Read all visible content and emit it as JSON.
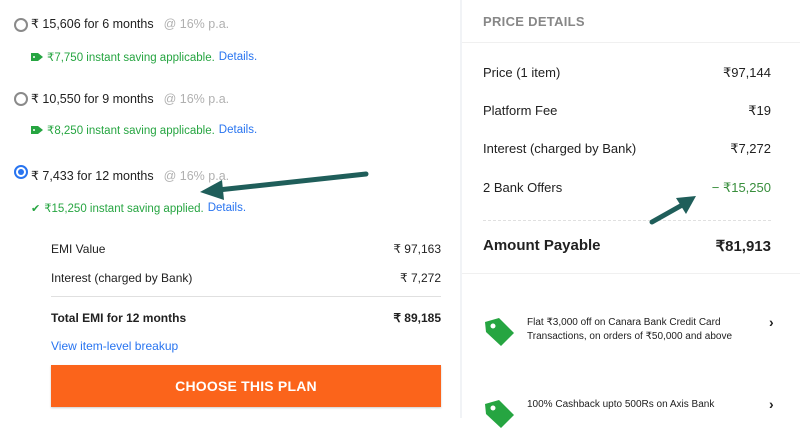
{
  "plans": [
    {
      "emi": "₹ 15,606 for 6 months",
      "rate": "@ 16% p.a.",
      "saving": "₹7,750 instant saving applicable.",
      "details": "Details.",
      "selected": false
    },
    {
      "emi": "₹ 10,550 for 9 months",
      "rate": "@ 16% p.a.",
      "saving": "₹8,250 instant saving applicable.",
      "details": "Details.",
      "selected": false
    },
    {
      "emi": "₹ 7,433 for 12 months",
      "rate": "@ 16% p.a.",
      "saving": "₹15,250 instant saving applied.",
      "details": "Details.",
      "selected": true
    }
  ],
  "summary": {
    "emi_value_label": "EMI Value",
    "emi_value": "₹ 97,163",
    "interest_label": "Interest (charged by Bank)",
    "interest": "₹ 7,272",
    "total_label": "Total EMI for 12 months",
    "total": "₹ 89,185",
    "breakup_link": "View item-level breakup",
    "choose_button": "CHOOSE THIS PLAN"
  },
  "price_details": {
    "title": "PRICE DETAILS",
    "rows": [
      {
        "label": "Price (1 item)",
        "value": "₹97,144"
      },
      {
        "label": "Platform Fee",
        "value": "₹19"
      },
      {
        "label": "Interest (charged by Bank)",
        "value": "₹7,272"
      },
      {
        "label": "2 Bank Offers",
        "value": "− ₹15,250"
      }
    ],
    "amount_label": "Amount Payable",
    "amount_value": "₹81,913"
  },
  "offers": [
    {
      "text": "Flat ₹3,000 off on Canara Bank Credit Card Transactions, on orders of ₹50,000 and above",
      "icon": "offer-tag-icon"
    },
    {
      "text": "100% Cashback upto 500Rs on Axis Bank",
      "icon": "offer-tag-icon"
    }
  ],
  "colors": {
    "accent": "#2874f0",
    "green": "#26a541",
    "button": "#fb641b",
    "annotation_arrow": "#1f5e5a"
  }
}
